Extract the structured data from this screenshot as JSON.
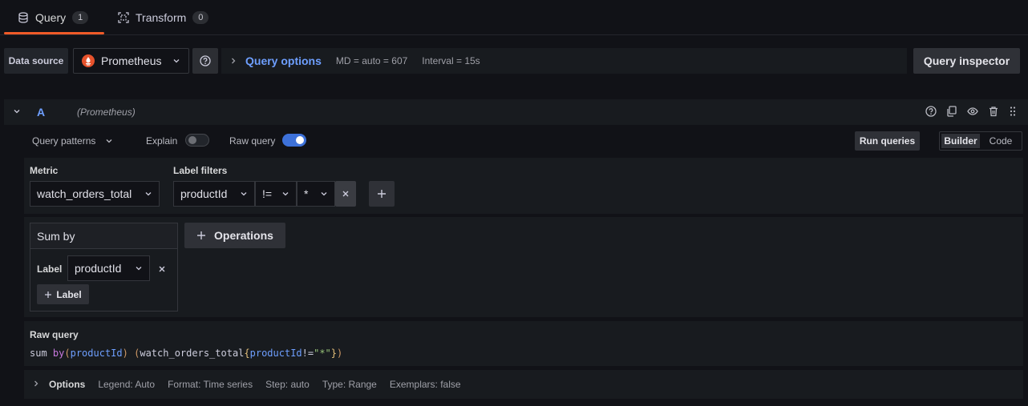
{
  "tabs": [
    {
      "label": "Query",
      "count": "1",
      "icon": "database-icon"
    },
    {
      "label": "Transform",
      "count": "0",
      "icon": "transform-icon"
    }
  ],
  "datasource": {
    "label": "Data source",
    "selected": "Prometheus",
    "query_options_title": "Query options",
    "md": "MD = auto = 607",
    "interval": "Interval = 15s",
    "inspector_label": "Query inspector"
  },
  "query": {
    "letter": "A",
    "datasource_hint": "(Prometheus)",
    "patterns_label": "Query patterns",
    "explain_label": "Explain",
    "explain_on": false,
    "raw_query_label": "Raw query",
    "raw_query_on": true,
    "run_label": "Run queries",
    "modes": [
      "Builder",
      "Code"
    ],
    "active_mode": "Builder"
  },
  "metric": {
    "label": "Metric",
    "value": "watch_orders_total"
  },
  "label_filters": {
    "label": "Label filters",
    "key": "productId",
    "operator": "!=",
    "value": "*"
  },
  "operation": {
    "title": "Sum by",
    "param_label": "Label",
    "param_value": "productId",
    "add_label": "Label",
    "operations_label": "Operations"
  },
  "raw_query": {
    "title": "Raw query",
    "parts": {
      "fn": "sum",
      "by": " by",
      "paren_open": "(",
      "label": "productId",
      "paren_close": ")",
      "space": " ",
      "outer_open": "(",
      "metric": "watch_orders_total",
      "brace_open": "{",
      "fkey": "productId",
      "op": "!=",
      "fval": "\"*\"",
      "brace_close": "}",
      "outer_close": ")"
    }
  },
  "options": {
    "label": "Options",
    "legend": "Legend: Auto",
    "format": "Format: Time series",
    "step": "Step: auto",
    "type": "Type: Range",
    "exemplars": "Exemplars: false"
  },
  "colors": {
    "accent": "#6e9fff",
    "tab_indicator": "#f05a28",
    "toggle_on": "#3d71d9",
    "prometheus": "#e6522c"
  }
}
